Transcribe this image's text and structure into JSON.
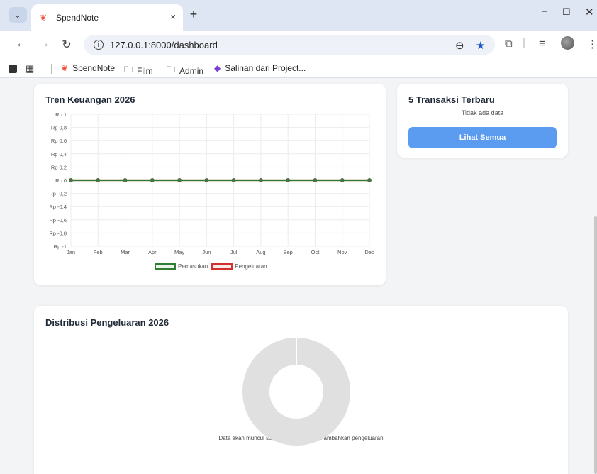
{
  "browser": {
    "tab_title": "SpendNote",
    "tab_close": "×",
    "new_tab": "+",
    "url": "127.0.0.1:8000/dashboard",
    "bookmarks": [
      {
        "label": "SpendNote"
      },
      {
        "label": "Film"
      },
      {
        "label": "Admin"
      },
      {
        "label": "Salinan dari Project..."
      }
    ]
  },
  "trend_card": {
    "title": "Tren Keuangan 2026"
  },
  "chart_data": [
    {
      "type": "line",
      "title": "Tren Keuangan 2026",
      "categories": [
        "Jan",
        "Feb",
        "Mar",
        "Apr",
        "May",
        "Jun",
        "Jul",
        "Aug",
        "Sep",
        "Oct",
        "Nov",
        "Dec"
      ],
      "y_tick_labels": [
        "Rp 1",
        "Rp 0,8",
        "Rp 0,6",
        "Rp 0,4",
        "Rp 0,2",
        "Rp 0",
        "Rp -0,2",
        "Rp -0,4",
        "Rp -0,6",
        "Rp -0,8",
        "Rp -1"
      ],
      "ylim": [
        -1,
        1
      ],
      "grid": true,
      "legend_position": "bottom",
      "series": [
        {
          "name": "Pemasukan",
          "color": "#2e7d32",
          "values": [
            0,
            0,
            0,
            0,
            0,
            0,
            0,
            0,
            0,
            0,
            0,
            0
          ]
        },
        {
          "name": "Pengeluaran",
          "color": "#d32f2f",
          "values": [
            0,
            0,
            0,
            0,
            0,
            0,
            0,
            0,
            0,
            0,
            0,
            0
          ]
        }
      ]
    },
    {
      "type": "pie",
      "title": "Distribusi Pengeluaran 2026",
      "values": [
        1
      ],
      "colors": [
        "#e0e0e0"
      ]
    }
  ],
  "recent_card": {
    "title": "5 Transaksi Terbaru",
    "empty_text": "Tidak ada data",
    "button_label": "Lihat Semua"
  },
  "dist_card": {
    "title": "Distribusi Pengeluaran 2026",
    "note": "Data akan muncul setelah pengguna menambahkan pengeluaran"
  }
}
